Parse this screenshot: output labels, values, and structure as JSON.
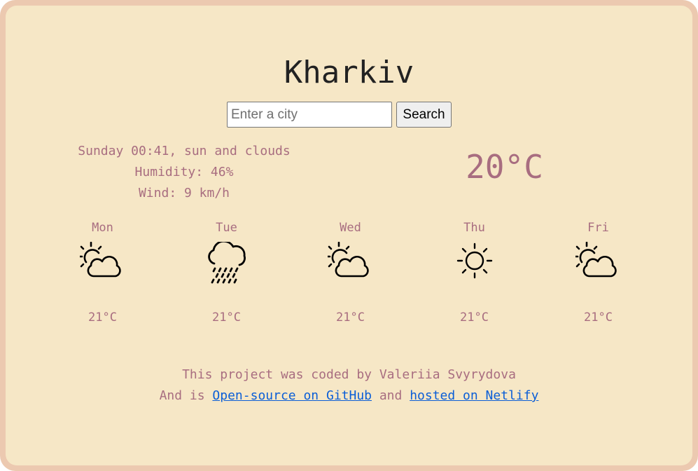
{
  "city": "Kharkiv",
  "search": {
    "placeholder": "Enter a city",
    "button_label": "Search"
  },
  "current": {
    "datetime_description": "Sunday 00:41, sun and clouds",
    "humidity": "Humidity: 46%",
    "wind": "Wind: 9 km/h",
    "temperature": "20°C"
  },
  "forecast": [
    {
      "day": "Mon",
      "icon": "sun-behind-cloud-icon",
      "temp": "21°C"
    },
    {
      "day": "Tue",
      "icon": "rain-cloud-icon",
      "temp": "21°C"
    },
    {
      "day": "Wed",
      "icon": "sun-behind-cloud-icon",
      "temp": "21°C"
    },
    {
      "day": "Thu",
      "icon": "sun-icon",
      "temp": "21°C"
    },
    {
      "day": "Fri",
      "icon": "sun-behind-cloud-icon",
      "temp": "21°C"
    }
  ],
  "footer": {
    "line1": "This project was coded by Valeriia Svyrydova",
    "prefix": "And is ",
    "github_link": "Open-source on GitHub",
    "middle": " and ",
    "netlify_link": "hosted on Netlify"
  },
  "colors": {
    "frame": "#ecc9b0",
    "card": "#f6e7c6",
    "text_accent": "#a86d80",
    "link": "#0b5ed7"
  }
}
